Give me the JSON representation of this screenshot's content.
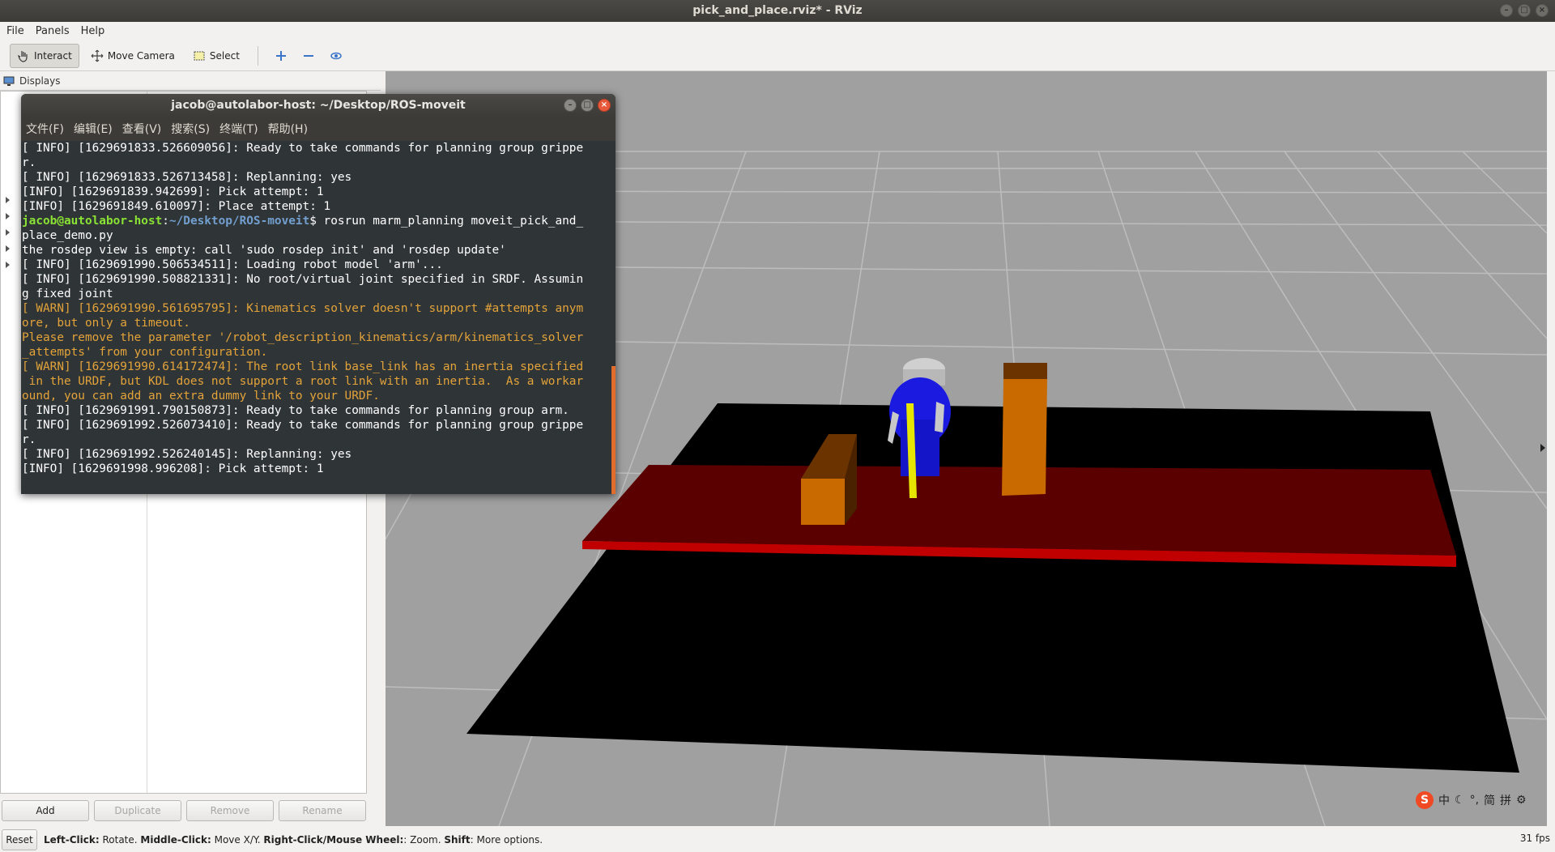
{
  "window": {
    "title": "pick_and_place.rviz* - RViz",
    "controls": [
      "minimize",
      "maximize",
      "close"
    ]
  },
  "menubar": {
    "items": [
      "File",
      "Panels",
      "Help"
    ]
  },
  "toolbar": {
    "interact_label": "Interact",
    "move_camera_label": "Move Camera",
    "select_label": "Select",
    "icons": [
      "plus-icon",
      "minus-icon",
      "eye-icon"
    ]
  },
  "displays_panel": {
    "title": "Displays",
    "buttons": {
      "add": "Add",
      "duplicate": "Duplicate",
      "remove": "Remove",
      "rename": "Rename"
    }
  },
  "terminal": {
    "title": "jacob@autolabor-host: ~/Desktop/ROS-moveit",
    "menu": [
      "文件(F)",
      "编辑(E)",
      "查看(V)",
      "搜索(S)",
      "终端(T)",
      "帮助(H)"
    ],
    "prompt_user": "jacob@autolabor-host",
    "prompt_path": "~/Desktop/ROS-moveit",
    "lines": [
      "[ INFO] [1629691833.526609056]: Ready to take commands for planning group grippe",
      "r.",
      "[ INFO] [1629691833.526713458]: Replanning: yes",
      "[INFO] [1629691839.942699]: Pick attempt: 1",
      "[INFO] [1629691849.610097]: Place attempt: 1",
      "$ rosrun marm_planning moveit_pick_and_",
      "place_demo.py",
      "the rosdep view is empty: call 'sudo rosdep init' and 'rosdep update'",
      "[ INFO] [1629691990.506534511]: Loading robot model 'arm'...",
      "[ INFO] [1629691990.508821331]: No root/virtual joint specified in SRDF. Assumin",
      "g fixed joint",
      "[ WARN] [1629691990.561695795]: Kinematics solver doesn't support #attempts anym",
      "ore, but only a timeout.",
      "Please remove the parameter '/robot_description_kinematics/arm/kinematics_solver",
      "_attempts' from your configuration.",
      "[ WARN] [1629691990.614172474]: The root link base_link has an inertia specified",
      " in the URDF, but KDL does not support a root link with an inertia.  As a workar",
      "ound, you can add an extra dummy link to your URDF.",
      "[ INFO] [1629691991.790150873]: Ready to take commands for planning group arm.",
      "[ INFO] [1629691992.526073410]: Ready to take commands for planning group grippe",
      "r.",
      "[ INFO] [1629691992.526240145]: Replanning: yes",
      "[INFO] [1629691998.996208]: Pick attempt: 1"
    ]
  },
  "statusbar": {
    "reset_label": "Reset",
    "hint_1b": "Left-Click:",
    "hint_1": " Rotate. ",
    "hint_2b": "Middle-Click:",
    "hint_2": " Move X/Y. ",
    "hint_3b": "Right-Click/Mouse Wheel:",
    "hint_3": ": Zoom. ",
    "hint_4b": "Shift",
    "hint_4": ": More options.",
    "fps": "31 fps"
  },
  "ime_tray": {
    "logo": "S",
    "items": [
      "中",
      "☾",
      "°,",
      "简",
      "拼",
      "⚙"
    ]
  },
  "colors": {
    "scene_background": "#303030",
    "floor": "#000000",
    "table": "#5a0000",
    "table_edge": "#c00000",
    "box": "#c86a00",
    "robot_base": "#1a1ae0",
    "gripper_finger": "#e6e600"
  }
}
